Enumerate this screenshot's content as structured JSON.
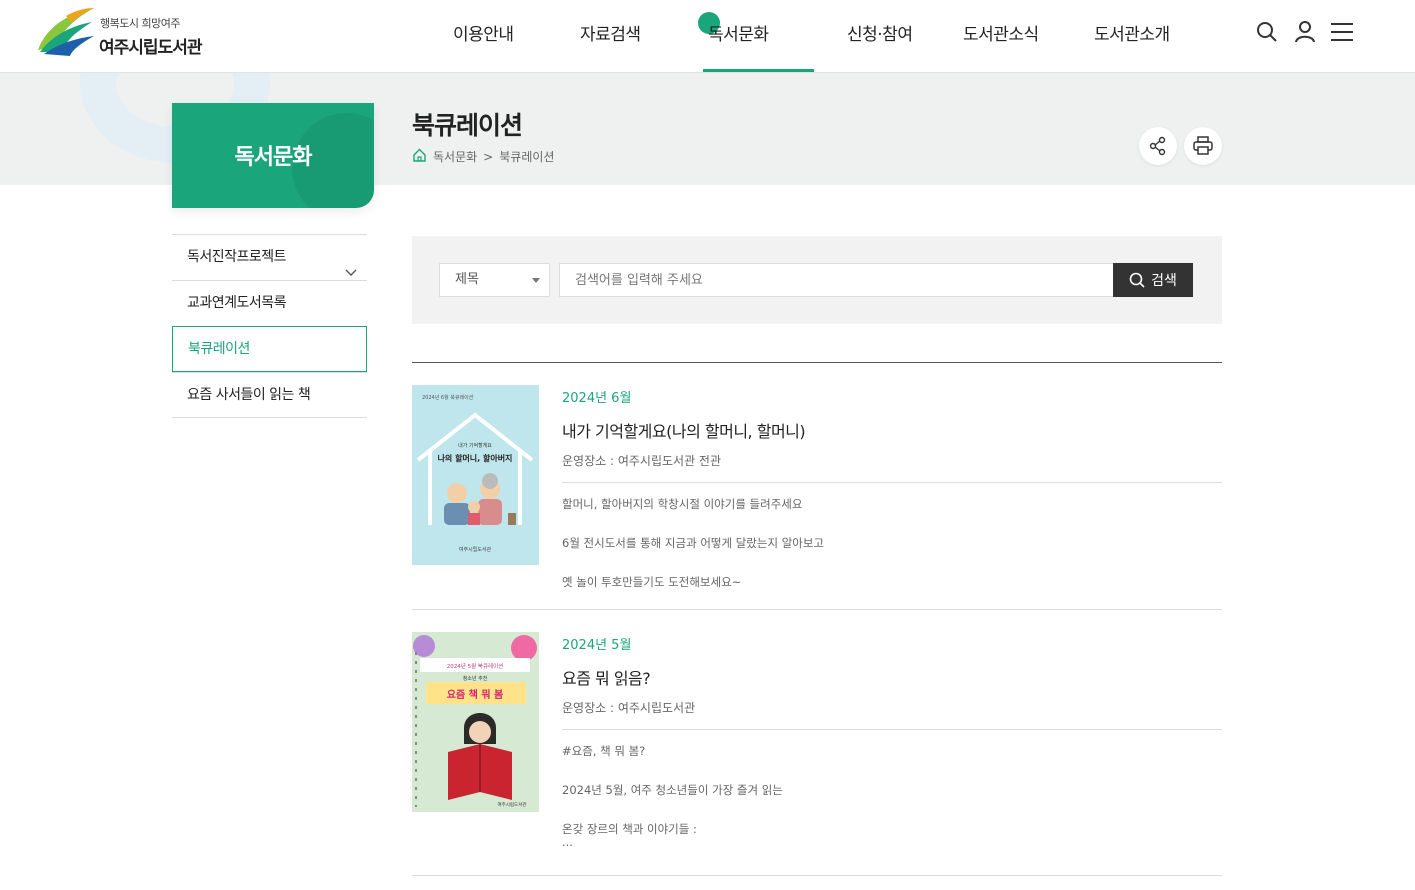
{
  "header": {
    "logo_sub": "행복도시 희망여주",
    "logo_main": "여주시립도서관",
    "nav": [
      "이용안내",
      "자료검색",
      "독서문화",
      "신청·참여",
      "도서관소식",
      "도서관소개"
    ],
    "active_nav_index": 2,
    "icons": [
      "search-icon",
      "user-icon",
      "menu-icon"
    ]
  },
  "section": {
    "lnb_title": "독서문화",
    "page_title": "북큐레이션",
    "breadcrumb": [
      "독서문화",
      ">",
      "북큐레이션"
    ],
    "actions": [
      "share-icon",
      "print-icon"
    ]
  },
  "sidebar": {
    "items": [
      {
        "label": "독서진작프로젝트"
      },
      {
        "label": "교과연계도서목록"
      },
      {
        "label": "북큐레이션"
      },
      {
        "label": "요즘 사서들이 읽는 책"
      }
    ],
    "active_index": 2
  },
  "search": {
    "select_value": "제목",
    "placeholder": "검색어를 입력해 주세요",
    "button_label": "검색"
  },
  "list": [
    {
      "date": "2024년 6월",
      "title": "내가 기억할게요(나의 할머니, 할머니)",
      "place": "운영장소 : 여주시립도서관 전관",
      "desc": [
        "할머니, 할아버지의 학창시절 이야기를 들려주세요",
        "6월 전시도서를 통해 지금과 어떻게 달랐는지 알아보고",
        "옛 놀이 투호만들기도 도전해보세요~"
      ],
      "thumb_text": {
        "top": "2024년 6월 북큐레이션",
        "mid": "내가 기억할게요",
        "main": "나의 할머니, 할아버지",
        "bottom": "여주시립도서관"
      }
    },
    {
      "date": "2024년 5월",
      "title": "요즘 뭐 읽음?",
      "place": "운영장소 : 여주시립도서관",
      "desc": [
        "#요즘, 책 뭐 봄?",
        "2024년 5월, 여주 청소년들이 가장 즐겨 읽는",
        "온갖 장르의 책과 이야기들 :",
        "..."
      ],
      "thumb_text": {
        "top": "2024년 5월 북큐레이션",
        "mid": "청소년 추천",
        "main": "요즘 책 뭐 봄",
        "bottom": "여주시립도서관"
      }
    }
  ]
}
